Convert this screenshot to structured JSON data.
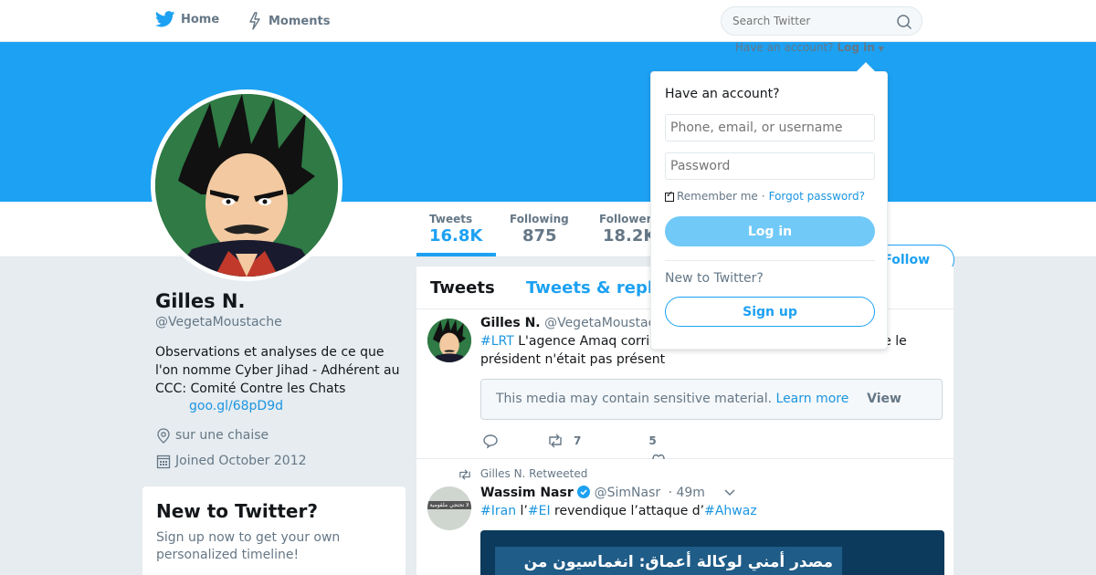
{
  "nav": {
    "home_label": "Home",
    "moments_label": "Moments",
    "search_placeholder": "Search Twitter",
    "have_account": "Have an account?",
    "login_link": "Log in"
  },
  "profile": {
    "name": "Gilles N.",
    "handle": "@VegetaMoustache",
    "bio": "Observations et analyses de ce que l'on nomme Cyber Jihad - Adhérent au CCC: Comité Contre les Chats",
    "link": "goo.gl/68pD9d",
    "location": "sur une chaise",
    "joined": "Joined October 2012",
    "follow_label": "Follow"
  },
  "stats": [
    {
      "label": "Tweets",
      "value": "16.8K"
    },
    {
      "label": "Following",
      "value": "875"
    },
    {
      "label": "Followers",
      "value": "18.2K"
    }
  ],
  "signup_box": {
    "title": "New to Twitter?",
    "text": "Sign up now to get your own personalized timeline!"
  },
  "timeline": {
    "tabs": [
      "Tweets",
      "Tweets & replies"
    ],
    "tweets": [
      {
        "name": "Gilles N.",
        "handle": "@VegetaMoustache",
        "hashtag": "#LRT",
        "text": " L'agence Amaq corrige son communiqué en précisant que le président n'était pas présent",
        "sensitive_text": "This media may contain sensitive material.",
        "learn_more": "Learn more",
        "view": "View",
        "retweets": "7",
        "likes": "5"
      },
      {
        "retweeted_by": "Gilles N. Retweeted",
        "name": "Wassim Nasr",
        "handle": "@SimNasr",
        "time": "· 49m",
        "text_parts": [
          "#Iran",
          " l’",
          "#EI",
          " revendique l’attaque d’",
          "#Ahwaz"
        ],
        "media_text": "مصدر أمني لوكالة أعماق: انغماسيون من",
        "avatar_text": "لا تحتجي ملقومية"
      }
    ]
  },
  "login_dropdown": {
    "title": "Have an account?",
    "username_placeholder": "Phone, email, or username",
    "password_placeholder": "Password",
    "remember": "Remember me",
    "separator": "·",
    "forgot": "Forgot password?",
    "login_button": "Log in",
    "new_label": "New to Twitter?",
    "signup_button": "Sign up"
  },
  "colors": {
    "accent": "#1da1f2",
    "link": "#1b95e0",
    "banner": "#1da1f2",
    "background": "#e6ecf0"
  }
}
